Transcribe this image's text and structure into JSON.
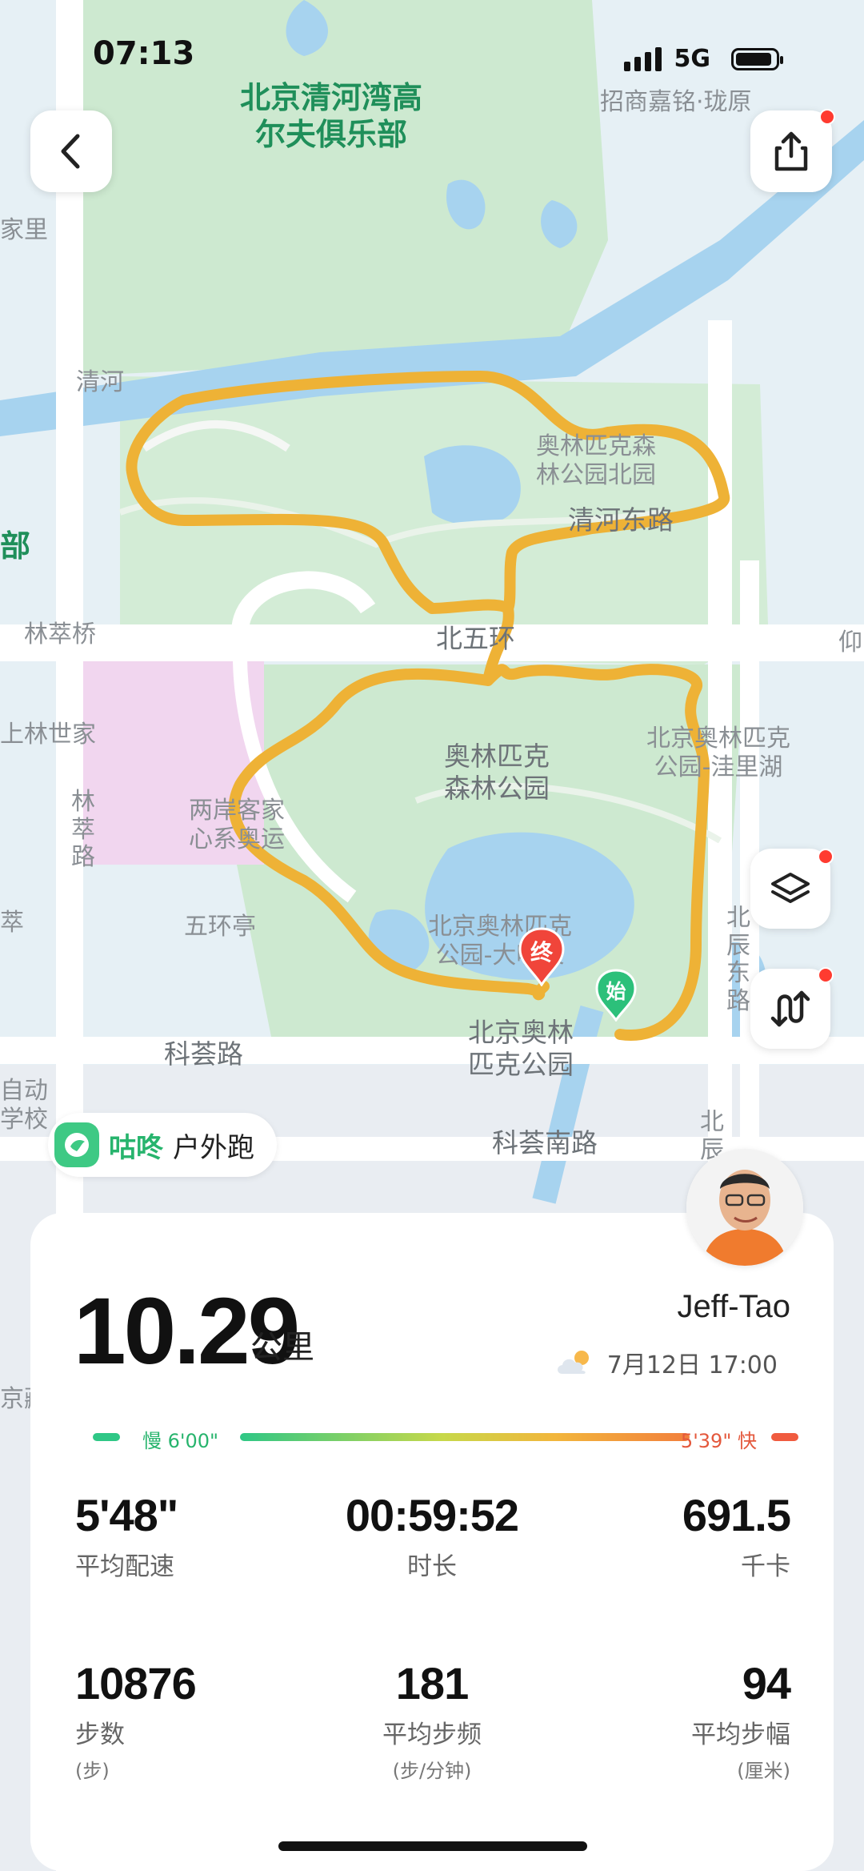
{
  "status": {
    "time": "07:13",
    "network": "5G"
  },
  "map": {
    "labels": [
      {
        "id": "golf",
        "text": "北京清河湾高\n尔夫俱乐部",
        "style": "green"
      },
      {
        "id": "zhaoshang",
        "text": "招商嘉铭·珑原",
        "style": "normal"
      },
      {
        "id": "qinghe",
        "text": "清河",
        "style": "normal"
      },
      {
        "id": "aolin-north",
        "text": "奥林匹克森\n林公园北园",
        "style": "normal"
      },
      {
        "id": "qinghe-east",
        "text": "清河东路",
        "style": "dark"
      },
      {
        "id": "lincuiqiao",
        "text": "林萃桥",
        "style": "normal"
      },
      {
        "id": "beiwuhuan",
        "text": "北五环",
        "style": "dark"
      },
      {
        "id": "shanglin",
        "text": "上林世家",
        "style": "normal"
      },
      {
        "id": "lincuilu",
        "text": "林萃路",
        "style": "vert"
      },
      {
        "id": "aolin-forest",
        "text": "奥林匹克\n森林公园",
        "style": "dark"
      },
      {
        "id": "wali",
        "text": "北京奥林匹克\n公园-洼里湖",
        "style": "normal"
      },
      {
        "id": "liangan",
        "text": "两岸客家\n心系奥运",
        "style": "normal"
      },
      {
        "id": "wuhuanting",
        "text": "五环亭",
        "style": "normal"
      },
      {
        "id": "dahuquan",
        "text": "北京奥林匹克\n公园-大喷泉",
        "style": "normal"
      },
      {
        "id": "beichen",
        "text": "北辰东路",
        "style": "vert"
      },
      {
        "id": "kehuilu",
        "text": "科荟路",
        "style": "dark"
      },
      {
        "id": "aolinpark",
        "text": "北京奥林\n匹克公园",
        "style": "dark"
      },
      {
        "id": "kehuinan",
        "text": "科荟南路",
        "style": "dark"
      },
      {
        "id": "left-bu",
        "text": "部",
        "style": "green"
      },
      {
        "id": "left-cui",
        "text": "萃",
        "style": "normal"
      },
      {
        "id": "left-zidong",
        "text": "自动\n学校",
        "style": "normal"
      },
      {
        "id": "left-li",
        "text": "家里",
        "style": "normal"
      },
      {
        "id": "right-bei",
        "text": "北辰",
        "style": "vert"
      },
      {
        "id": "right-yang",
        "text": "仰",
        "style": "normal"
      },
      {
        "id": "jing",
        "text": "京藏",
        "style": "normal"
      }
    ],
    "start_marker": "始",
    "end_marker": "终",
    "colors": {
      "route": "#eeb236",
      "water": "#a7d3ef",
      "park": "#cde9d0"
    }
  },
  "app": {
    "name": "咕咚",
    "activity": "户外跑",
    "logo_icon": "gudong-bird-icon"
  },
  "run": {
    "distance": "10.29",
    "distance_unit": "公里",
    "user": "Jeff-Tao",
    "date": "7月12日 17:00",
    "weather_icon": "partly-cloudy-icon",
    "pace_slow": "慢 6'00\"",
    "pace_fast": "5'39\" 快"
  },
  "stats": [
    {
      "value": "5'48\"",
      "label": "平均配速",
      "unit": ""
    },
    {
      "value": "00:59:52",
      "label": "时长",
      "unit": ""
    },
    {
      "value": "691.5",
      "label": "千卡",
      "unit": ""
    },
    {
      "value": "10876",
      "label": "步数",
      "unit": "(步)"
    },
    {
      "value": "181",
      "label": "平均步频",
      "unit": "(步/分钟)"
    },
    {
      "value": "94",
      "label": "平均步幅",
      "unit": "(厘米)"
    }
  ]
}
